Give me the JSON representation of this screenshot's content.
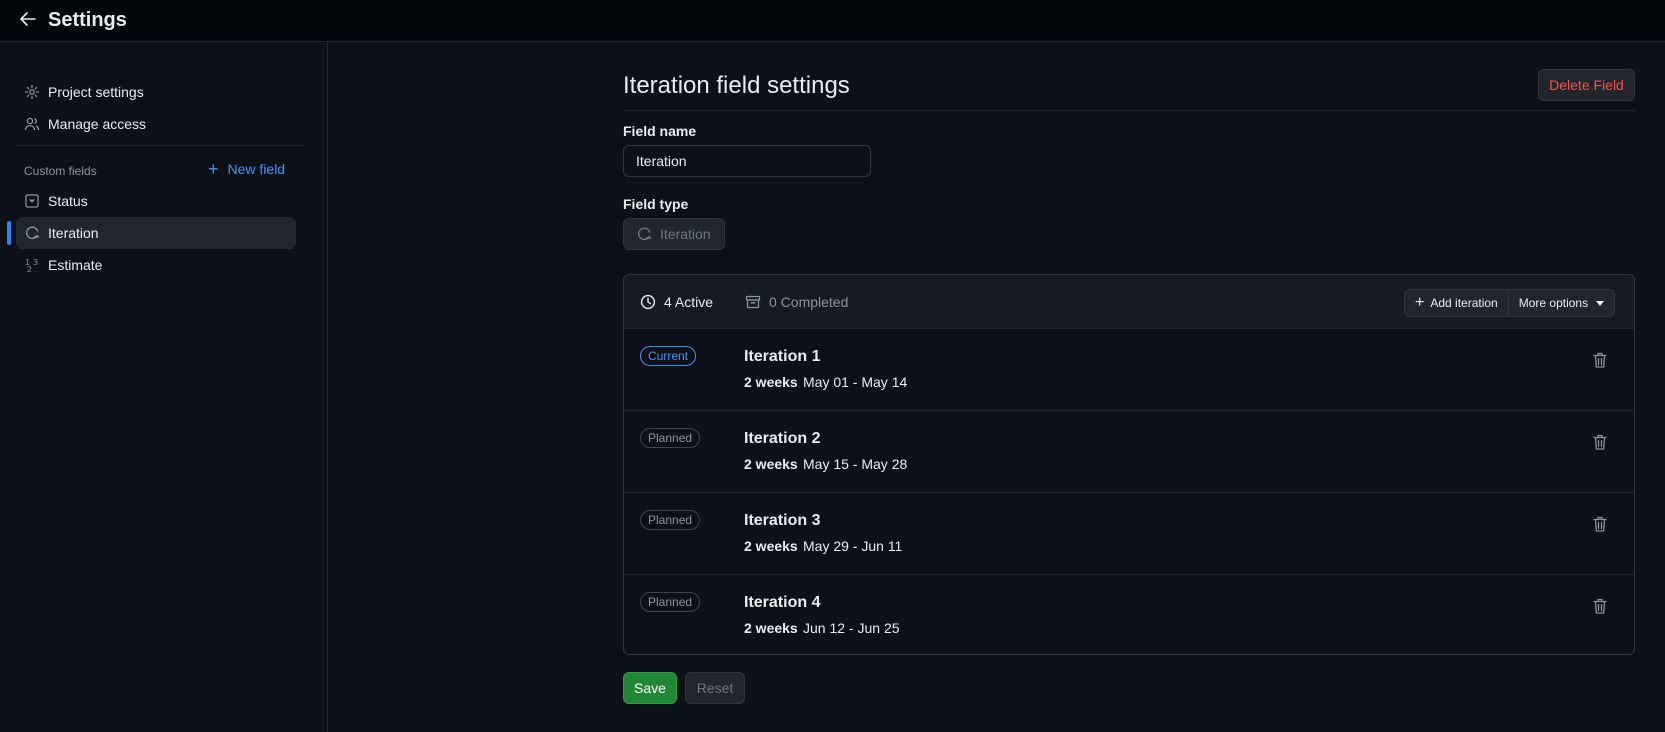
{
  "header": {
    "title": "Settings",
    "back_icon": "arrow-left-icon"
  },
  "sidebar": {
    "items": [
      {
        "label": "Project settings",
        "icon": "gear-icon"
      },
      {
        "label": "Manage access",
        "icon": "people-icon"
      }
    ],
    "custom_fields_label": "Custom fields",
    "new_field_label": "New field",
    "fields": [
      {
        "label": "Status",
        "icon": "single-select-icon"
      },
      {
        "label": "Iteration",
        "icon": "iteration-icon",
        "active": true
      },
      {
        "label": "Estimate",
        "icon": "number-icon"
      }
    ]
  },
  "main": {
    "title": "Iteration field settings",
    "delete_label": "Delete Field",
    "field_name_label": "Field name",
    "field_name_value": "Iteration",
    "field_type_label": "Field type",
    "field_type_value": "Iteration"
  },
  "iterations": {
    "active_tab": "4 Active",
    "completed_tab": "0 Completed",
    "add_label": "Add iteration",
    "more_label": "More options",
    "rows": [
      {
        "status": "Current",
        "name": "Iteration 1",
        "duration": "2 weeks",
        "dates": "May 01 - May 14"
      },
      {
        "status": "Planned",
        "name": "Iteration 2",
        "duration": "2 weeks",
        "dates": "May 15 - May 28"
      },
      {
        "status": "Planned",
        "name": "Iteration 3",
        "duration": "2 weeks",
        "dates": "May 29 - Jun 11"
      },
      {
        "status": "Planned",
        "name": "Iteration 4",
        "duration": "2 weeks",
        "dates": "Jun 12 - Jun 25"
      }
    ]
  },
  "footer": {
    "save_label": "Save",
    "reset_label": "Reset"
  },
  "colors": {
    "accent": "#2f81f7",
    "danger": "#f85149",
    "success": "#238636",
    "background": "#0d1117"
  }
}
